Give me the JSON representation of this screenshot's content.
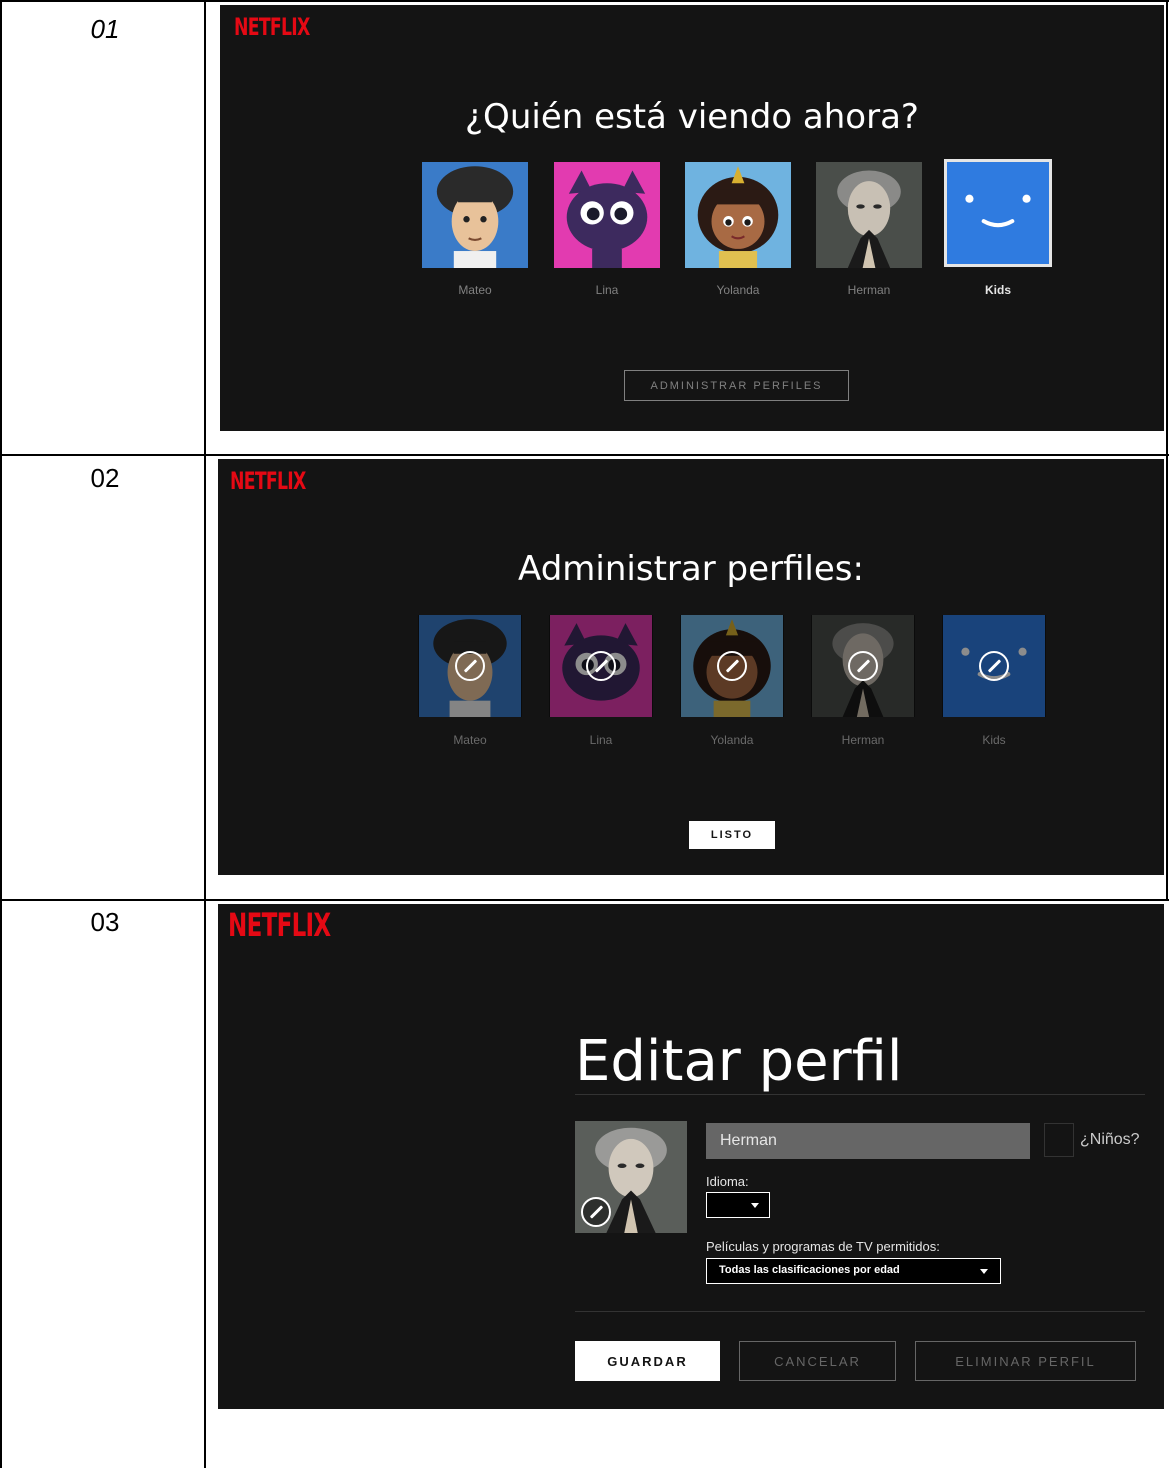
{
  "steps": [
    {
      "number": "01",
      "logo": "NETFLIX",
      "title": "¿Quién está viendo ahora?",
      "profiles": [
        {
          "name": "Mateo",
          "icon": "boy-cartoon-avatar"
        },
        {
          "name": "Lina",
          "icon": "purple-cat-avatar"
        },
        {
          "name": "Yolanda",
          "icon": "girl-cartoon-avatar"
        },
        {
          "name": "Herman",
          "icon": "man-portrait-avatar"
        },
        {
          "name": "Kids",
          "icon": "kids-smiley-avatar"
        }
      ],
      "button": "ADMINISTRAR PERFILES"
    },
    {
      "number": "02",
      "logo": "NETFLIX",
      "title": "Administrar perfiles:",
      "profiles": [
        {
          "name": "Mateo"
        },
        {
          "name": "Lina"
        },
        {
          "name": "Yolanda"
        },
        {
          "name": "Herman"
        },
        {
          "name": "Kids"
        }
      ],
      "button": "LISTO"
    },
    {
      "number": "03",
      "logo": "NETFLIX",
      "title": "Editar perfil",
      "name_value": "Herman",
      "kids_label": "¿Niños?",
      "language_label": "Idioma:",
      "maturity_label": "Películas y programas de TV permitidos:",
      "maturity_value": "Todas las clasificaciones por edad",
      "save": "GUARDAR",
      "cancel": "CANCELAR",
      "delete": "ELIMINAR PERFIL"
    }
  ],
  "colors": {
    "netflix_red": "#e50914",
    "background": "#141414"
  }
}
